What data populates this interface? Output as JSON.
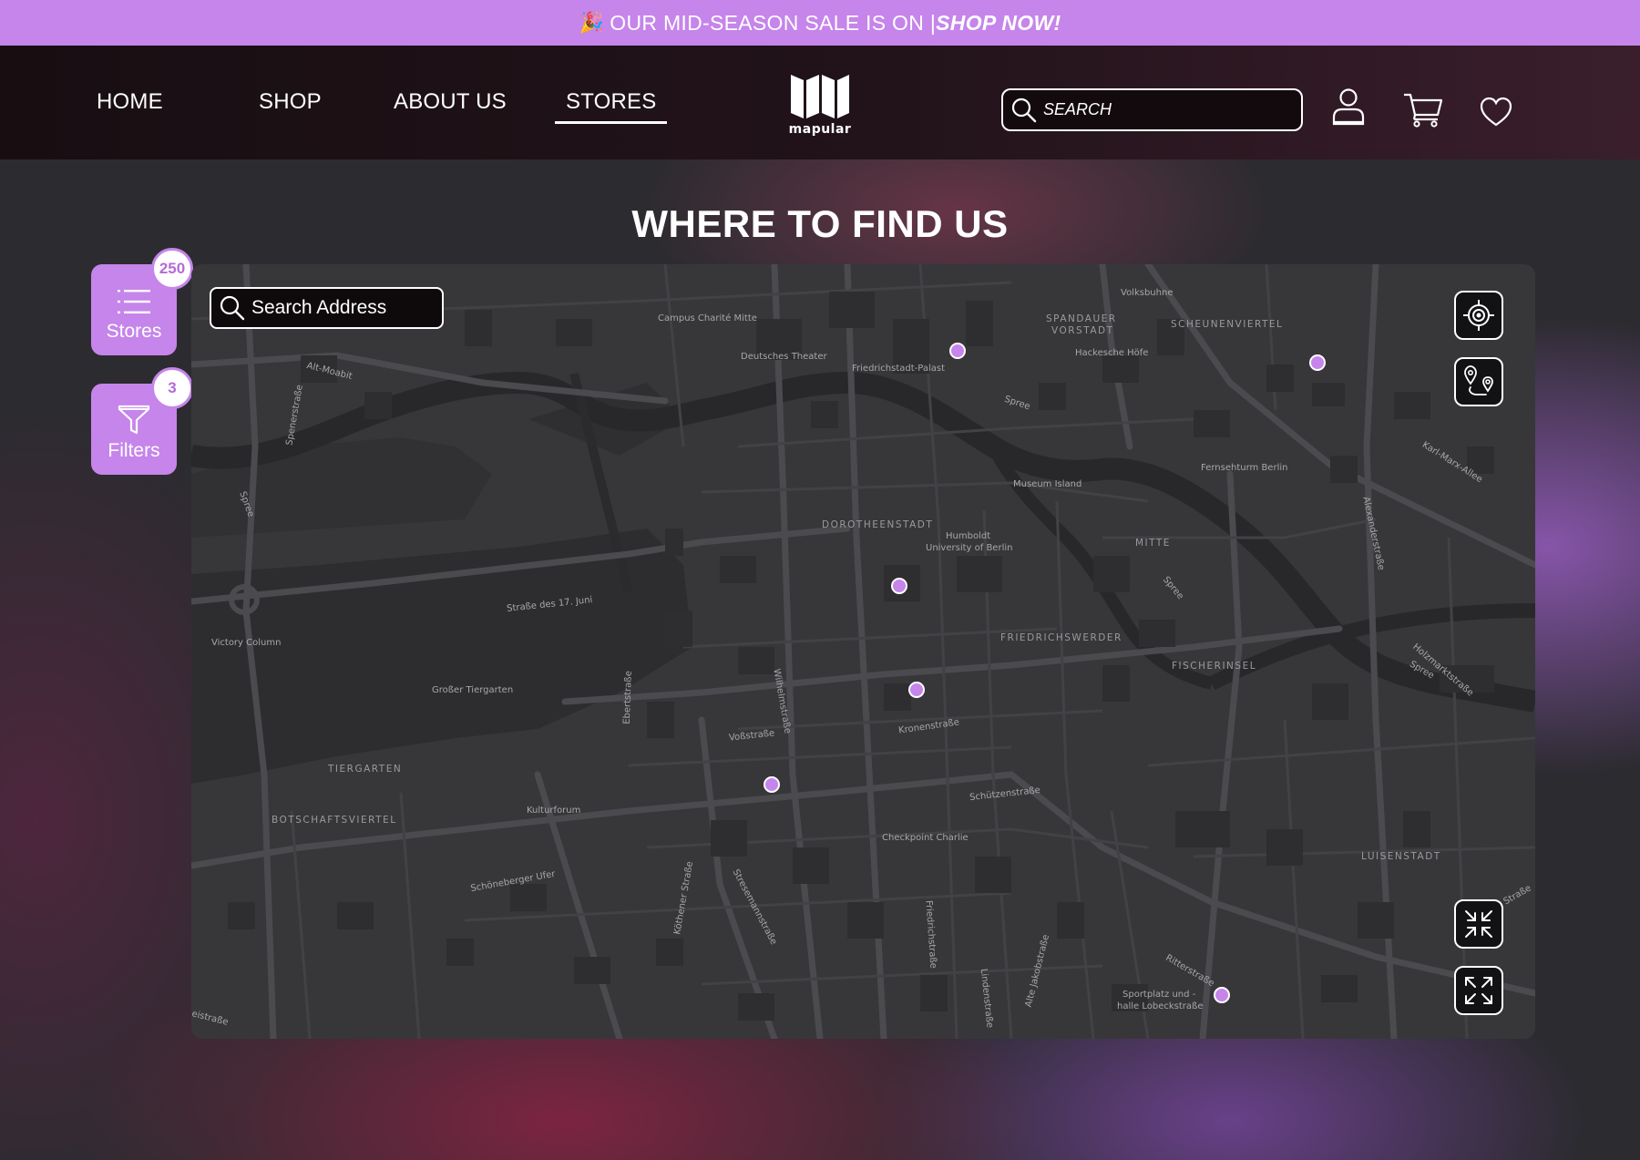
{
  "promo": {
    "emoji": "🎉",
    "text": "OUR MID-SEASON SALE IS ON | ",
    "cta": "SHOP NOW!"
  },
  "nav": {
    "home": "HOME",
    "shop": "SHOP",
    "about": "ABOUT US",
    "stores": "STORES",
    "active": "STORES"
  },
  "logo": {
    "word": "mapular"
  },
  "header_search": {
    "placeholder": "SEARCH"
  },
  "page_title": "WHERE TO FIND US",
  "side_panel": {
    "stores_label": "Stores",
    "stores_count": "250",
    "filters_label": "Filters",
    "filters_count": "3"
  },
  "map": {
    "search_placeholder": "Search Address",
    "labels": {
      "volksbuhne": "Volksbuhne",
      "campus": "Campus Charité Mitte",
      "spandauer": "SPANDAUER",
      "vorstadt": "VORSTADT",
      "scheunen": "SCHEUNENVIERTEL",
      "deutsches": "Deutsches Theater",
      "friedrichstadt_palast": "Friedrichstadt-Palast",
      "hackesche": "Hackesche Höfe",
      "alt_moabit": "Alt-Moabit",
      "spree1": "Spree",
      "spree2": "Spree",
      "spree3": "Spree",
      "spree4": "Spree",
      "fernsehturm": "Fernsehturm Berlin",
      "museum_island": "Museum Island",
      "karl_marx": "Karl-Marx-Allee",
      "dorotheenstadt": "DOROTHEENSTADT",
      "humboldt1": "Humboldt",
      "humboldt2": "University of Berlin",
      "mitte": "MITTE",
      "alexanderstrasse": "Alexanderstraße",
      "strasse17juni": "Straße des 17. Juni",
      "victory": "Victory Column",
      "friedrichswerder": "FRIEDRICHSWERDER",
      "fischerinsel": "FISCHERINSEL",
      "holzmarkt": "Holzmarktstraße",
      "tiergarten_park": "Großer Tiergarten",
      "ebertstrasse": "Ebertstraße",
      "wilhelmstrasse": "Wilhelmstraße",
      "vossstrasse": "Voßstraße",
      "kronenstrasse": "Kronenstraße",
      "tiergarten": "TIERGARTEN",
      "kulturforum": "Kulturforum",
      "schutzenstrasse": "Schützenstraße",
      "botschafts": "BOTSCHAFTSVIERTEL",
      "checkpoint": "Checkpoint Charlie",
      "luisenstadt": "LUISENSTADT",
      "schoneberger": "Schöneberger Ufer",
      "kothener": "Köthener Straße",
      "stresemann": "Stresemannstraße",
      "friedrichstrasse": "Friedrichstraße",
      "lindenstrasse": "Lindenstraße",
      "alte_jakob": "Alte Jakobstraße",
      "ritterstrasse": "Ritterstraße",
      "sportplatz1": "Sportplatz und -",
      "sportplatz2": "halle Lobeckstraße",
      "spenerstrasse": "Spenerstraße",
      "kohlfurter": "Kohlfurter Straße",
      "west_street": "eistraße"
    }
  },
  "colors": {
    "accent": "#c585ea",
    "header_bg": "#180e12",
    "map_bg": "#37373a"
  },
  "icons": {
    "search": "search-icon",
    "user": "user-icon",
    "cart": "cart-icon",
    "heart": "heart-icon",
    "list": "list-icon",
    "filter": "filter-funnel-icon",
    "locate": "locate-target-icon",
    "route": "route-pins-icon",
    "collapse": "collapse-icon",
    "expand": "expand-icon"
  }
}
